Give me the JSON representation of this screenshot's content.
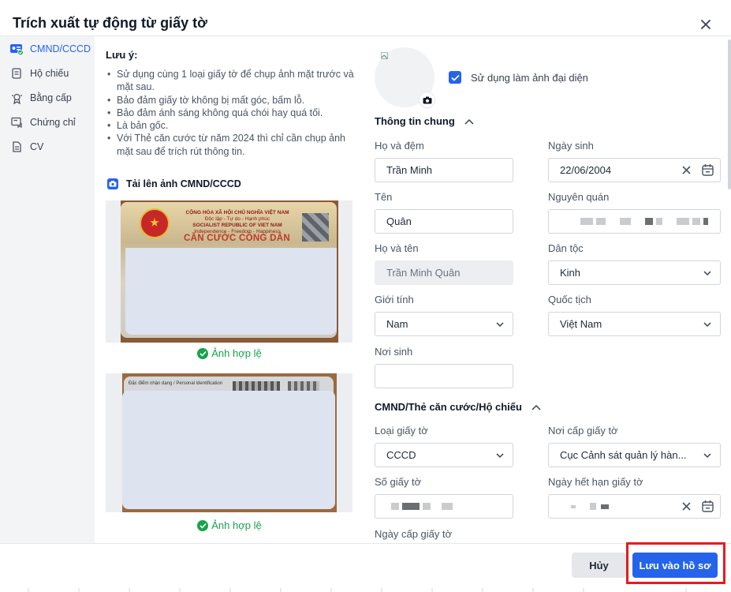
{
  "modal": {
    "title": "Trích xuất tự động từ giấy tờ",
    "close_icon": "close-icon"
  },
  "sidebar": {
    "items": [
      {
        "label": "CMND/CCCD",
        "icon": "id-card-icon",
        "active": true
      },
      {
        "label": "Hộ chiếu",
        "icon": "passport-icon",
        "active": false
      },
      {
        "label": "Bằng cấp",
        "icon": "certificate-icon",
        "active": false
      },
      {
        "label": "Chứng chỉ",
        "icon": "award-icon",
        "active": false
      },
      {
        "label": "CV",
        "icon": "document-icon",
        "active": false
      }
    ]
  },
  "notes": {
    "title": "Lưu ý:",
    "items": [
      "Sử dụng cùng 1 loại giấy tờ để chụp ảnh mặt trước và mặt sau.",
      "Bảo đảm giấy tờ không bị mất góc, bấm lỗ.",
      "Bảo đảm ánh sáng không quá chói hay quá tối.",
      "Là bản gốc.",
      "Với Thẻ căn cước từ năm 2024 thì chỉ cần chụp ảnh mặt sau để trích rút thông tin."
    ]
  },
  "upload": {
    "title": "Tải lên ảnh CMND/CCCD",
    "front": {
      "card_header_1": "CỘNG HÒA XÃ HỘI CHỦ NGHĨA VIỆT NAM",
      "card_header_2": "Độc lập - Tự do - Hạnh phúc",
      "card_header_3": "SOCIALIST REPUBLIC OF VIET NAM",
      "card_header_4": "Independence - Freedom - Happiness",
      "card_title": "CĂN CƯỚC CÔNG DÂN",
      "status": "Ảnh hợp lệ"
    },
    "back": {
      "card_header": "Đặc điểm nhận dạng / Personal identification",
      "status": "Ảnh hợp lệ"
    }
  },
  "avatar": {
    "checkbox_label": "Sử dụng làm ảnh đại diện",
    "checked": true
  },
  "general": {
    "title": "Thông tin chung",
    "ho_va_dem": {
      "label": "Họ và đệm",
      "value": "Trần Minh"
    },
    "ngay_sinh": {
      "label": "Ngày sinh",
      "value": "22/06/2004"
    },
    "ten": {
      "label": "Tên",
      "value": "Quân"
    },
    "nguyen_quan": {
      "label": "Nguyên quán",
      "value": ""
    },
    "ho_va_ten": {
      "label": "Họ và tên",
      "value": "Trần Minh Quân"
    },
    "dan_toc": {
      "label": "Dân tộc",
      "value": "Kinh"
    },
    "gioi_tinh": {
      "label": "Giới tính",
      "value": "Nam"
    },
    "quoc_tich": {
      "label": "Quốc tịch",
      "value": "Việt Nam"
    },
    "noi_sinh": {
      "label": "Nơi sinh",
      "value": ""
    }
  },
  "id_doc": {
    "title": "CMND/Thẻ căn cước/Hộ chiếu",
    "loai_giay_to": {
      "label": "Loại giấy tờ",
      "value": "CCCD"
    },
    "noi_cap": {
      "label": "Nơi cấp giấy tờ",
      "value": "Cục Cảnh sát quản lý hàn..."
    },
    "so_giay_to": {
      "label": "Số giấy tờ",
      "value": ""
    },
    "ngay_het_han": {
      "label": "Ngày hết hạn giấy tờ",
      "value": ""
    },
    "ngay_cap": {
      "label": "Ngày cấp giấy tờ"
    }
  },
  "footer": {
    "cancel_label": "Hủy",
    "save_label": "Lưu vào hồ sơ"
  },
  "colors": {
    "primary": "#2563eb",
    "success": "#16a34a",
    "highlight": "#e11d22"
  }
}
